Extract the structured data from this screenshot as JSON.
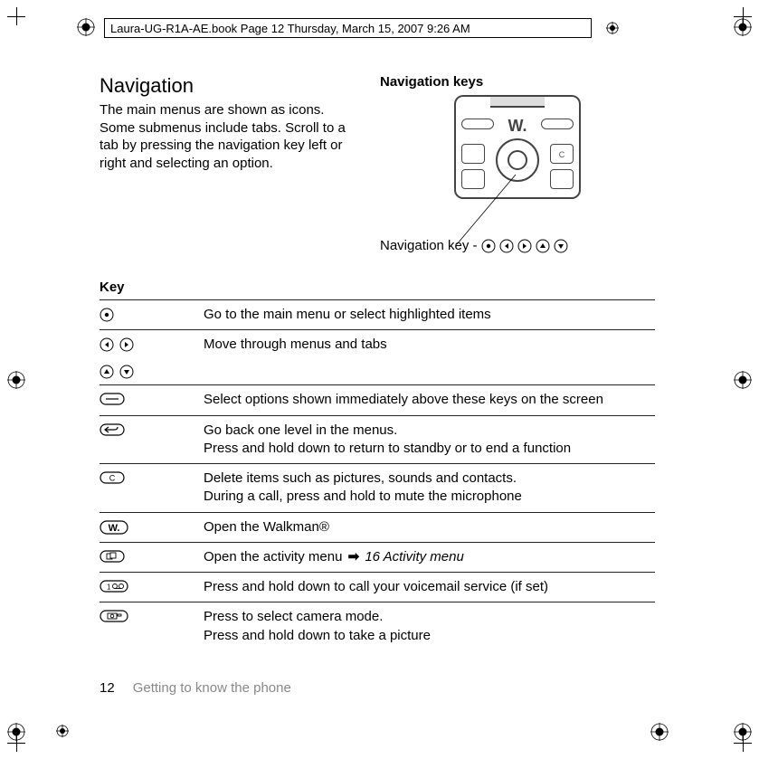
{
  "header": {
    "text": "Laura-UG-R1A-AE.book  Page 12  Thursday, March 15, 2007  9:26 AM"
  },
  "left_column": {
    "heading": "Navigation",
    "paragraph": "The main menus are shown as icons. Some submenus include tabs. Scroll to a tab by pressing the navigation key left or right and selecting an option."
  },
  "right_column": {
    "subheading": "Navigation keys",
    "callout_label": "Navigation key - "
  },
  "key_table": {
    "header": "Key",
    "rows": [
      {
        "desc": "Go to the main menu or select highlighted items"
      },
      {
        "desc": "Move through menus and tabs"
      },
      {
        "desc": "Select options shown immediately above these keys on the screen"
      },
      {
        "desc": "Go back one level in the menus.\nPress and hold down to return to standby or to end a function"
      },
      {
        "desc": "Delete items such as pictures, sounds and contacts.\nDuring a call, press and hold to mute the microphone"
      },
      {
        "desc": "Open the Walkman®"
      },
      {
        "desc_prefix": "Open the activity menu ",
        "xref": "16 Activity menu"
      },
      {
        "desc": "Press and hold down to call your voicemail service (if set)"
      },
      {
        "desc": "Press to select camera mode.\nPress and hold down to take a picture"
      }
    ]
  },
  "footer": {
    "page": "12",
    "section": "Getting to know the phone"
  }
}
